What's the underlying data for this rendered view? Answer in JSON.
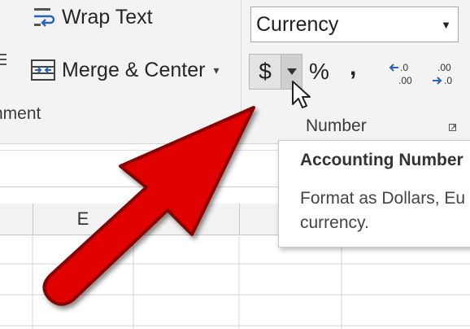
{
  "ribbon": {
    "alignment": {
      "group_label": "nment",
      "wrap_text_label": "Wrap Text",
      "merge_center_label": "Merge & Center"
    },
    "number": {
      "group_label": "Number",
      "format_value": "Currency",
      "accounting_symbol": "$",
      "percent_symbol": "%",
      "comma_symbol": ","
    }
  },
  "tooltip": {
    "title": "Accounting Number",
    "line1": "Format as Dollars, Eu",
    "line2": "currency."
  },
  "sheet": {
    "column_headers": [
      "",
      "E",
      "",
      ""
    ]
  },
  "colors": {
    "arrow_red": "#e00000",
    "ribbon_bg": "#f3f3f3",
    "accent_blue": "#2b63b6"
  }
}
